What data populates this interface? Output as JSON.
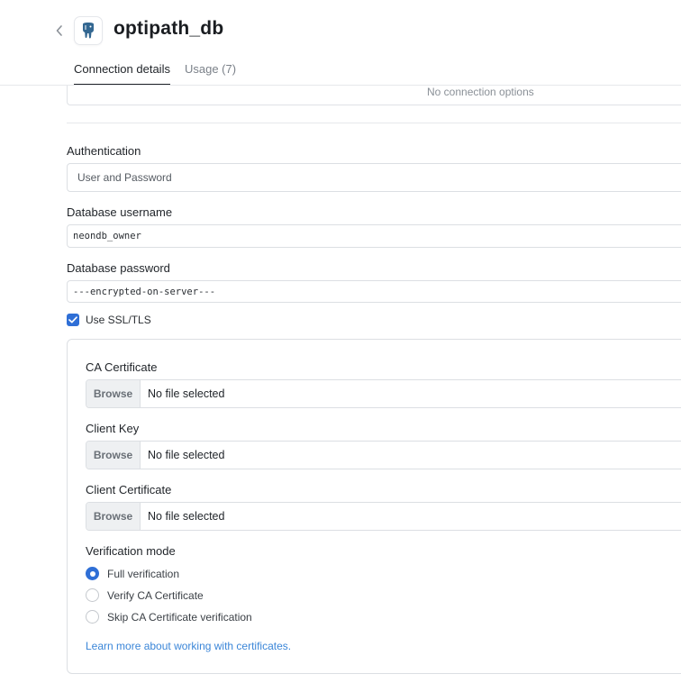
{
  "header": {
    "title": "optipath_db",
    "back_icon": "chevron-left-icon",
    "logo_icon": "postgresql-elephant-icon"
  },
  "tabs": [
    {
      "label": "Connection details",
      "active": true
    },
    {
      "label": "Usage (7)",
      "active": false
    }
  ],
  "connection_options": {
    "empty_text": "No connection options"
  },
  "authentication": {
    "label": "Authentication",
    "value": "User and Password"
  },
  "username": {
    "label": "Database username",
    "value": "neondb_owner"
  },
  "password": {
    "label": "Database password",
    "value": "---encrypted-on-server---"
  },
  "ssl": {
    "label": "Use SSL/TLS",
    "checked": true,
    "ca_certificate": {
      "label": "CA Certificate",
      "button": "Browse",
      "status": "No file selected"
    },
    "client_key": {
      "label": "Client Key",
      "button": "Browse",
      "status": "No file selected"
    },
    "client_certificate": {
      "label": "Client Certificate",
      "button": "Browse",
      "status": "No file selected"
    },
    "verification": {
      "label": "Verification mode",
      "options": [
        {
          "label": "Full verification",
          "selected": true
        },
        {
          "label": "Verify CA Certificate",
          "selected": false
        },
        {
          "label": "Skip CA Certificate verification",
          "selected": false
        }
      ]
    },
    "learn_more": "Learn more about working with certificates."
  },
  "colors": {
    "accent": "#2f6fd6",
    "link": "#3b86d8",
    "border": "#dcdfe3"
  }
}
